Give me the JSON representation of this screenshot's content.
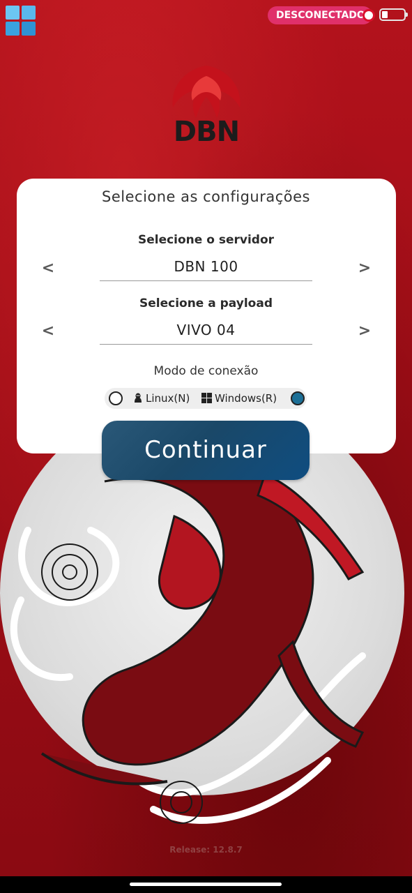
{
  "app": {
    "status": "DESCONECTADO",
    "logo_text": "DBN",
    "release": "Release: 12.8.7"
  },
  "card": {
    "title": "Selecione as configurações",
    "server": {
      "label": "Selecione o servidor",
      "value": "DBN 100",
      "prev": "<",
      "next": ">"
    },
    "payload": {
      "label": "Selecione a payload",
      "value": "VIVO 04",
      "prev": "<",
      "next": ">"
    },
    "mode": {
      "label": "Modo de conexão",
      "options": [
        "Linux(N)",
        "Windows(R)"
      ],
      "selected": "Windows(R)"
    }
  },
  "continue_label": "Continuar",
  "colors": {
    "background": "#a8101a",
    "status_pill": "#e0306a",
    "button": "#1a4868",
    "selected_radio": "#1c6f96"
  }
}
